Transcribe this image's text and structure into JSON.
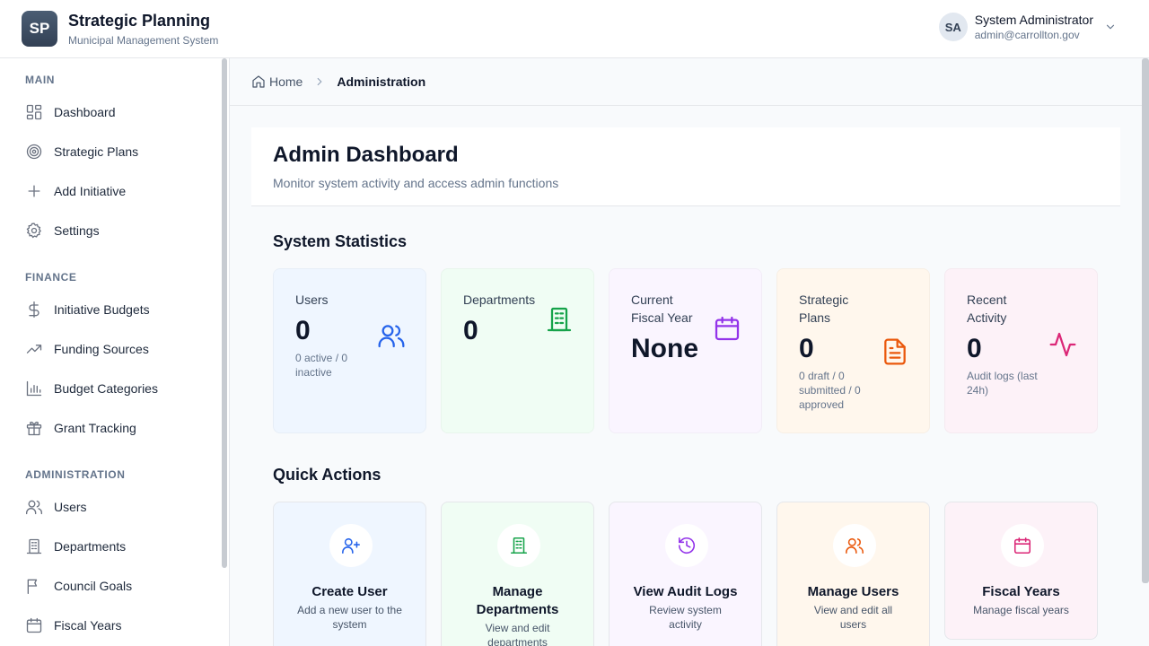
{
  "header": {
    "logo": "SP",
    "title": "Strategic Planning",
    "subtitle": "Municipal Management System",
    "user": {
      "initials": "SA",
      "name": "System Administrator",
      "email": "admin@carrollton.gov"
    }
  },
  "sidebar": {
    "sections": [
      {
        "label": "MAIN",
        "items": [
          {
            "label": "Dashboard",
            "icon": "grid-icon"
          },
          {
            "label": "Strategic Plans",
            "icon": "target-icon"
          },
          {
            "label": "Add Initiative",
            "icon": "plus-icon"
          },
          {
            "label": "Settings",
            "icon": "gear-icon"
          }
        ]
      },
      {
        "label": "FINANCE",
        "items": [
          {
            "label": "Initiative Budgets",
            "icon": "dollar-icon"
          },
          {
            "label": "Funding Sources",
            "icon": "trending-up-icon"
          },
          {
            "label": "Budget Categories",
            "icon": "bar-chart-icon"
          },
          {
            "label": "Grant Tracking",
            "icon": "gift-icon"
          }
        ]
      },
      {
        "label": "ADMINISTRATION",
        "items": [
          {
            "label": "Users",
            "icon": "users-icon"
          },
          {
            "label": "Departments",
            "icon": "building-icon"
          },
          {
            "label": "Council Goals",
            "icon": "flag-icon"
          },
          {
            "label": "Fiscal Years",
            "icon": "calendar-icon"
          }
        ]
      }
    ]
  },
  "breadcrumb": {
    "home": "Home",
    "current": "Administration"
  },
  "page": {
    "title": "Admin Dashboard",
    "description": "Monitor system activity and access admin functions"
  },
  "stats_heading": "System Statistics",
  "stats": [
    {
      "label": "Users",
      "value": "0",
      "sub": "0 active / 0 inactive",
      "icon": "users-icon",
      "color": "#2563eb",
      "bg": "#eff6ff"
    },
    {
      "label": "Departments",
      "value": "0",
      "sub": "",
      "icon": "building-icon",
      "color": "#16a34a",
      "bg": "#f0fdf4"
    },
    {
      "label": "Current Fiscal Year",
      "value": "None",
      "sub": "",
      "icon": "calendar-icon",
      "color": "#9333ea",
      "bg": "#faf5ff"
    },
    {
      "label": "Strategic Plans",
      "value": "0",
      "sub": "0 draft / 0 submitted / 0 approved",
      "icon": "document-icon",
      "color": "#ea580c",
      "bg": "#fff7ed"
    },
    {
      "label": "Recent Activity",
      "value": "0",
      "sub": "Audit logs (last 24h)",
      "icon": "activity-icon",
      "color": "#db2777",
      "bg": "#fdf2f8"
    }
  ],
  "actions_heading": "Quick Actions",
  "actions": [
    {
      "title": "Create User",
      "desc": "Add a new user to the system",
      "icon": "user-plus-icon",
      "color": "#2563eb",
      "bg": "#eff6ff"
    },
    {
      "title": "Manage Departments",
      "desc": "View and edit departments",
      "icon": "building-icon",
      "color": "#16a34a",
      "bg": "#f0fdf4"
    },
    {
      "title": "View Audit Logs",
      "desc": "Review system activity",
      "icon": "history-icon",
      "color": "#9333ea",
      "bg": "#faf5ff"
    },
    {
      "title": "Manage Users",
      "desc": "View and edit all users",
      "icon": "users-icon",
      "color": "#ea580c",
      "bg": "#fff7ed"
    },
    {
      "title": "Fiscal Years",
      "desc": "Manage fiscal years",
      "icon": "calendar-icon",
      "color": "#db2777",
      "bg": "#fdf2f8"
    }
  ]
}
